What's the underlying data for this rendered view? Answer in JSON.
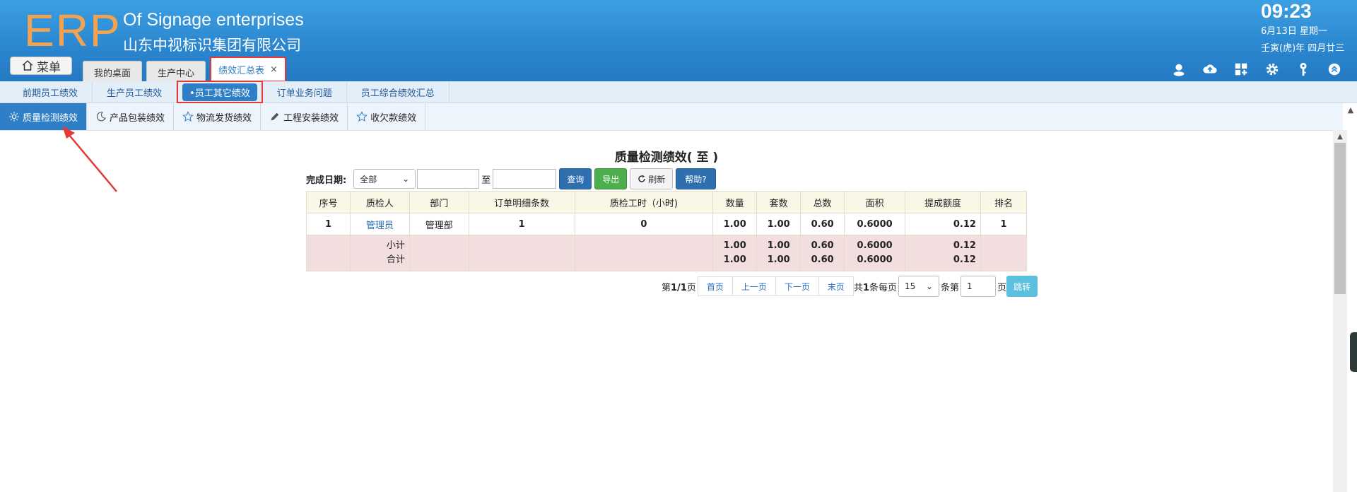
{
  "header": {
    "logo": "ERP",
    "company_en": "Of Signage enterprises",
    "company_cn": "山东中视标识集团有限公司",
    "menu_label": "菜单",
    "tabs": [
      {
        "label": "我的桌面"
      },
      {
        "label": "生产中心"
      },
      {
        "label": "绩效汇总表",
        "close": "×"
      }
    ],
    "clock": "09:23",
    "date": "6月13日 星期一",
    "lunar": "壬寅(虎)年 四月廿三",
    "toolbar_icons": [
      "user-icon",
      "cloud-upload-icon",
      "apps-icon",
      "gear-icon",
      "key-icon",
      "chevron-up-icon"
    ]
  },
  "subnav": {
    "items": [
      {
        "label": "前期员工绩效"
      },
      {
        "label": "生产员工绩效"
      },
      {
        "label": "•员工其它绩效"
      },
      {
        "label": "订单业务问题"
      },
      {
        "label": "员工综合绩效汇总"
      }
    ]
  },
  "category_tabs": [
    {
      "label": "质量检测绩效",
      "icon": "sun-icon"
    },
    {
      "label": "产品包装绩效",
      "icon": "moon-icon"
    },
    {
      "label": "物流发货绩效",
      "icon": "star-icon"
    },
    {
      "label": "工程安装绩效",
      "icon": "pencil-icon"
    },
    {
      "label": "收欠款绩效",
      "icon": "star-icon"
    }
  ],
  "report": {
    "title": "质量检测绩效( 至 )",
    "filter": {
      "label": "完成日期:",
      "select_value": "全部",
      "to": "至",
      "query": "查询",
      "export": "导出",
      "refresh": "刷新",
      "help": "帮助?"
    },
    "columns": [
      "序号",
      "质检人",
      "部门",
      "订单明细条数",
      "质检工时（小时)",
      "数量",
      "套数",
      "总数",
      "面积",
      "提成额度",
      "排名"
    ],
    "rows": [
      {
        "idx": "1",
        "inspector": "管理员",
        "dept": "管理部",
        "details": "1",
        "hours": "0",
        "qty": "1.00",
        "sets": "1.00",
        "total": "0.60",
        "area": "0.6000",
        "bonus": "0.12",
        "rank": "1"
      }
    ],
    "subtotal": {
      "label": "小计",
      "qty": "1.00",
      "sets": "1.00",
      "total": "0.60",
      "area": "0.6000",
      "bonus": "0.12"
    },
    "grandtotal": {
      "label": "合计",
      "qty": "1.00",
      "sets": "1.00",
      "total": "0.60",
      "area": "0.6000",
      "bonus": "0.12"
    }
  },
  "pager": {
    "page_info_pre": "第",
    "page_info": "1/1",
    "page_info_post": "页",
    "first": "首页",
    "prev": "上一页",
    "next": "下一页",
    "last": "末页",
    "total_pre": "共",
    "total": "1",
    "total_post": "条每页",
    "per_page": "15",
    "goto_pre": "条第",
    "goto_value": "1",
    "goto_post": "页",
    "go": "跳转"
  },
  "colors": {
    "header_blue": "#2a86cf",
    "logo_orange": "#f3a24e",
    "active_tab_blue": "#2f7fc6",
    "highlight_red": "#e53935",
    "export_green": "#4cae4c",
    "go_cyan": "#5bc0de",
    "summary_pink": "#f2dede"
  }
}
